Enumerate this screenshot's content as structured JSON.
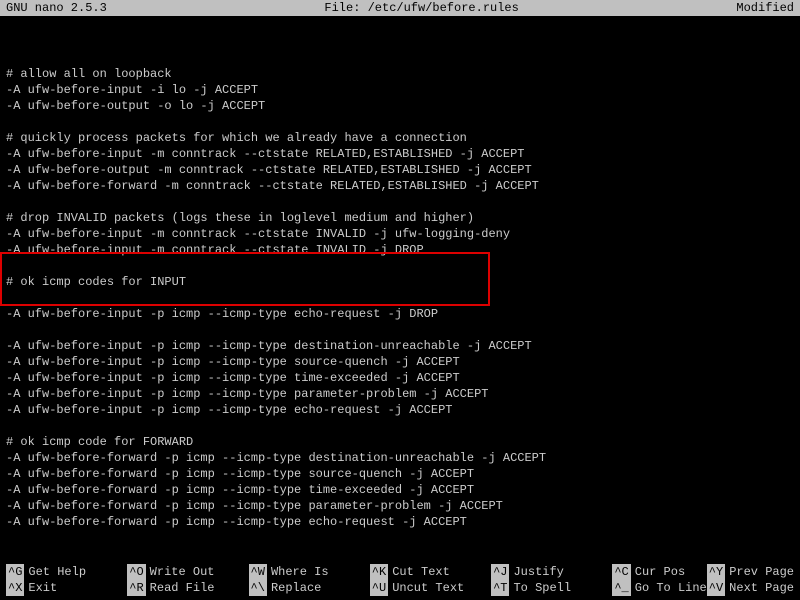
{
  "header": {
    "app": "  GNU nano 2.5.3",
    "filename": "File: /etc/ufw/before.rules",
    "status": "Modified  "
  },
  "content": "\n\n# allow all on loopback\n-A ufw-before-input -i lo -j ACCEPT\n-A ufw-before-output -o lo -j ACCEPT\n\n# quickly process packets for which we already have a connection\n-A ufw-before-input -m conntrack --ctstate RELATED,ESTABLISHED -j ACCEPT\n-A ufw-before-output -m conntrack --ctstate RELATED,ESTABLISHED -j ACCEPT\n-A ufw-before-forward -m conntrack --ctstate RELATED,ESTABLISHED -j ACCEPT\n\n# drop INVALID packets (logs these in loglevel medium and higher)\n-A ufw-before-input -m conntrack --ctstate INVALID -j ufw-logging-deny\n-A ufw-before-input -m conntrack --ctstate INVALID -j DROP\n\n# ok icmp codes for INPUT\n\n-A ufw-before-input -p icmp --icmp-type echo-request -j DROP\n\n-A ufw-before-input -p icmp --icmp-type destination-unreachable -j ACCEPT\n-A ufw-before-input -p icmp --icmp-type source-quench -j ACCEPT\n-A ufw-before-input -p icmp --icmp-type time-exceeded -j ACCEPT\n-A ufw-before-input -p icmp --icmp-type parameter-problem -j ACCEPT\n-A ufw-before-input -p icmp --icmp-type echo-request -j ACCEPT\n\n# ok icmp code for FORWARD\n-A ufw-before-forward -p icmp --icmp-type destination-unreachable -j ACCEPT\n-A ufw-before-forward -p icmp --icmp-type source-quench -j ACCEPT\n-A ufw-before-forward -p icmp --icmp-type time-exceeded -j ACCEPT\n-A ufw-before-forward -p icmp --icmp-type parameter-problem -j ACCEPT\n-A ufw-before-forward -p icmp --icmp-type echo-request -j ACCEPT",
  "shortcuts": [
    {
      "key": "^G",
      "label": "Get Help"
    },
    {
      "key": "^O",
      "label": "Write Out"
    },
    {
      "key": "^W",
      "label": "Where Is"
    },
    {
      "key": "^K",
      "label": "Cut Text"
    },
    {
      "key": "^J",
      "label": "Justify"
    },
    {
      "key": "^C",
      "label": "Cur Pos"
    },
    {
      "key": "^X",
      "label": "Exit"
    },
    {
      "key": "^R",
      "label": "Read File"
    },
    {
      "key": "^\\",
      "label": "Replace"
    },
    {
      "key": "^U",
      "label": "Uncut Text"
    },
    {
      "key": "^T",
      "label": "To Spell"
    },
    {
      "key": "^_",
      "label": "Go To Line"
    }
  ],
  "extra_shortcuts": [
    {
      "key": "^Y",
      "label": "Prev Page"
    },
    {
      "key": "^V",
      "label": "Next Page"
    }
  ]
}
